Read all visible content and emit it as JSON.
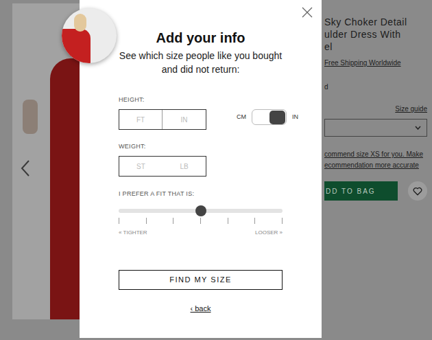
{
  "product": {
    "title_lines": [
      "Sky Choker Detail",
      "ulder Dress With",
      "el"
    ],
    "shipping": "Free Shipping Worldwide",
    "fragment": "d",
    "size_guide": "Size guide",
    "recommendation_lines": [
      "commend size XS for you. Make",
      "ecommendation more accurate"
    ],
    "add_button": "DD TO BAG",
    "wishlist": {
      "selected": false
    }
  },
  "modal": {
    "title": "Add your info",
    "subtitle": "See which size people like you bought and did not return:",
    "height": {
      "label": "HEIGHT:",
      "fields": [
        {
          "placeholder": "FT"
        },
        {
          "placeholder": "IN"
        }
      ]
    },
    "units": {
      "left": "CM",
      "right": "IN",
      "on": true
    },
    "weight": {
      "label": "WEIGHT:",
      "fields": [
        {
          "placeholder": "ST"
        },
        {
          "placeholder": "LB"
        }
      ]
    },
    "fit": {
      "label": "I PREFER A FIT THAT IS:",
      "level": 0.5,
      "min_label": "« TIGHTER",
      "max_label": "LOOSER »"
    },
    "button": "FIND MY SIZE",
    "back": "‹ back"
  }
}
